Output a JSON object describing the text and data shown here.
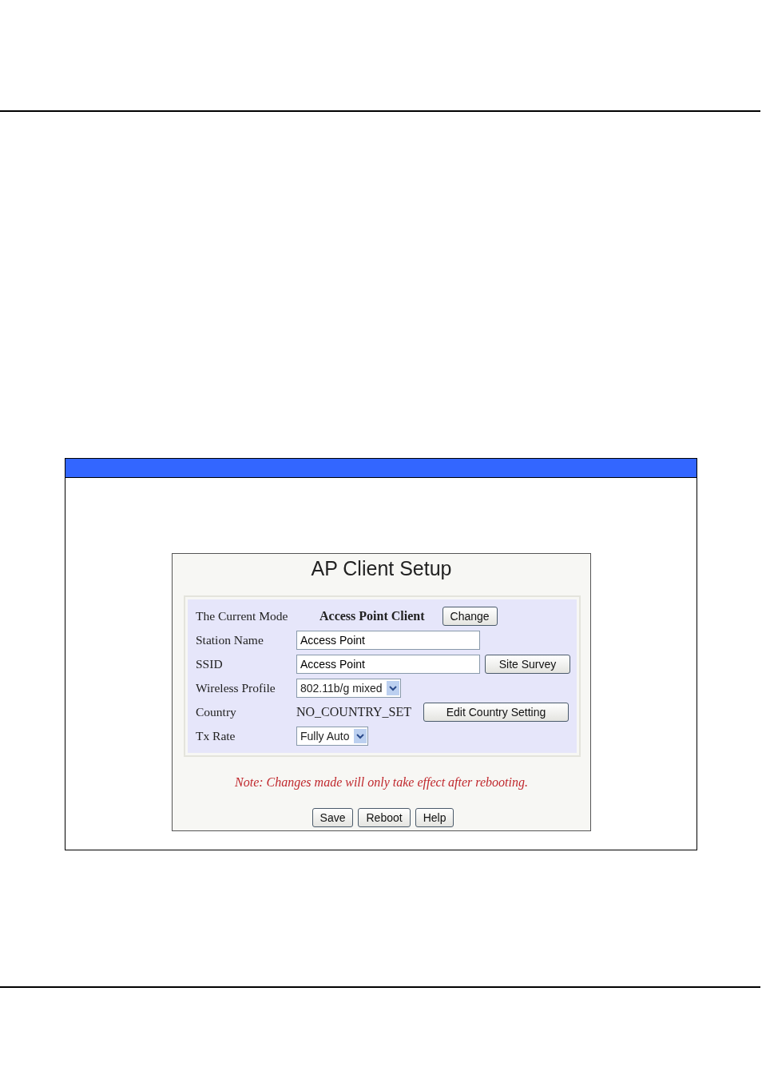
{
  "screen": {
    "title": "AP Client Setup",
    "rows": [
      {
        "kind": "mode",
        "label": "The Current Mode",
        "value": "Access Point Client",
        "button": "Change"
      },
      {
        "kind": "input",
        "label": "Station Name",
        "value": "Access Point"
      },
      {
        "kind": "input",
        "label": "SSID",
        "value": "Access Point",
        "button": "Site Survey"
      },
      {
        "kind": "select",
        "label": "Wireless Profile",
        "value": "802.11b/g mixed"
      },
      {
        "kind": "text",
        "label": "Country",
        "value": "NO_COUNTRY_SET",
        "button": "Edit Country Setting"
      },
      {
        "kind": "select",
        "label": "Tx Rate",
        "value": "Fully Auto"
      }
    ],
    "note": "Note: Changes made will only take effect after rebooting.",
    "buttons": [
      "Save",
      "Reboot",
      "Help"
    ]
  }
}
